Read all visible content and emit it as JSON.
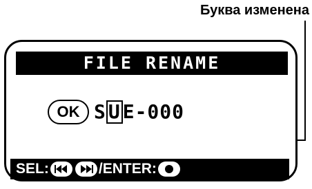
{
  "annotation": {
    "text": "Буква изменена"
  },
  "screen": {
    "title": "FILE RENAME",
    "ok_label": "OK",
    "filename": {
      "before": "S",
      "cursor_char": "U",
      "after": "E-000"
    },
    "bottom_bar": {
      "sel_label": "SEL:",
      "separator": "/",
      "enter_label": "ENTER:"
    }
  },
  "icons": [
    "rewind-button-icon",
    "fast-forward-button-icon",
    "record-button-icon"
  ]
}
